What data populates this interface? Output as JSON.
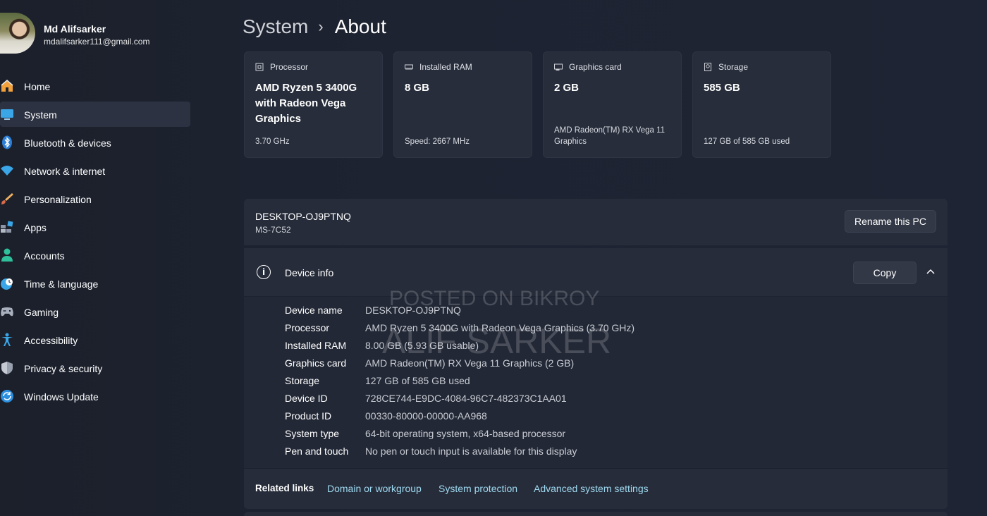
{
  "profile": {
    "name": "Md Alifsarker",
    "email": "mdalifsarker111@gmail.com"
  },
  "sidebar": {
    "items": [
      {
        "label": "Home",
        "icon": "home-icon",
        "active": false
      },
      {
        "label": "System",
        "icon": "system-icon",
        "active": true
      },
      {
        "label": "Bluetooth & devices",
        "icon": "bluetooth-icon",
        "active": false
      },
      {
        "label": "Network & internet",
        "icon": "wifi-icon",
        "active": false
      },
      {
        "label": "Personalization",
        "icon": "brush-icon",
        "active": false
      },
      {
        "label": "Apps",
        "icon": "apps-icon",
        "active": false
      },
      {
        "label": "Accounts",
        "icon": "person-icon",
        "active": false
      },
      {
        "label": "Time & language",
        "icon": "clock-globe-icon",
        "active": false
      },
      {
        "label": "Gaming",
        "icon": "gamepad-icon",
        "active": false
      },
      {
        "label": "Accessibility",
        "icon": "accessibility-icon",
        "active": false
      },
      {
        "label": "Privacy & security",
        "icon": "shield-icon",
        "active": false
      },
      {
        "label": "Windows Update",
        "icon": "update-icon",
        "active": false
      }
    ]
  },
  "breadcrumb": {
    "parent": "System",
    "separator": "›",
    "current": "About"
  },
  "cards": [
    {
      "title": "Processor",
      "icon": "processor-icon",
      "value": "AMD Ryzen 5 3400G with Radeon Vega Graphics",
      "sub": "3.70 GHz"
    },
    {
      "title": "Installed RAM",
      "icon": "ram-icon",
      "value": "8 GB",
      "sub": "Speed: 2667 MHz"
    },
    {
      "title": "Graphics card",
      "icon": "gpu-icon",
      "value": "2 GB",
      "sub": "AMD Radeon(TM) RX Vega 11 Graphics"
    },
    {
      "title": "Storage",
      "icon": "storage-icon",
      "value": "585 GB",
      "sub": "127 GB of 585 GB used"
    }
  ],
  "pc": {
    "name": "DESKTOP-OJ9PTNQ",
    "model": "MS-7C52",
    "rename_label": "Rename this PC"
  },
  "device_info": {
    "title": "Device info",
    "copy_label": "Copy",
    "specs": [
      {
        "label": "Device name",
        "value": "DESKTOP-OJ9PTNQ"
      },
      {
        "label": "Processor",
        "value": "AMD Ryzen 5 3400G with Radeon Vega Graphics (3.70 GHz)"
      },
      {
        "label": "Installed RAM",
        "value": "8.00 GB (5.93 GB usable)"
      },
      {
        "label": "Graphics card",
        "value": "AMD Radeon(TM) RX Vega 11 Graphics (2 GB)"
      },
      {
        "label": "Storage",
        "value": "127 GB of 585 GB used"
      },
      {
        "label": "Device ID",
        "value": "728CE744-E9DC-4084-96C7-482373C1AA01"
      },
      {
        "label": "Product ID",
        "value": "00330-80000-00000-AA968"
      },
      {
        "label": "System type",
        "value": "64-bit operating system, x64-based processor"
      },
      {
        "label": "Pen and touch",
        "value": "No pen or touch input is available for this display"
      }
    ]
  },
  "related": {
    "label": "Related links",
    "links": [
      "Domain or workgroup",
      "System protection",
      "Advanced system settings"
    ]
  },
  "watermark": {
    "line1": "POSTED ON BIKROY",
    "line2": "ALIF SARKER"
  },
  "colors": {
    "background": "#1c2230",
    "card": "#272d3b",
    "accent_link": "#9fd9f0",
    "active_nav": "#2c3241"
  }
}
